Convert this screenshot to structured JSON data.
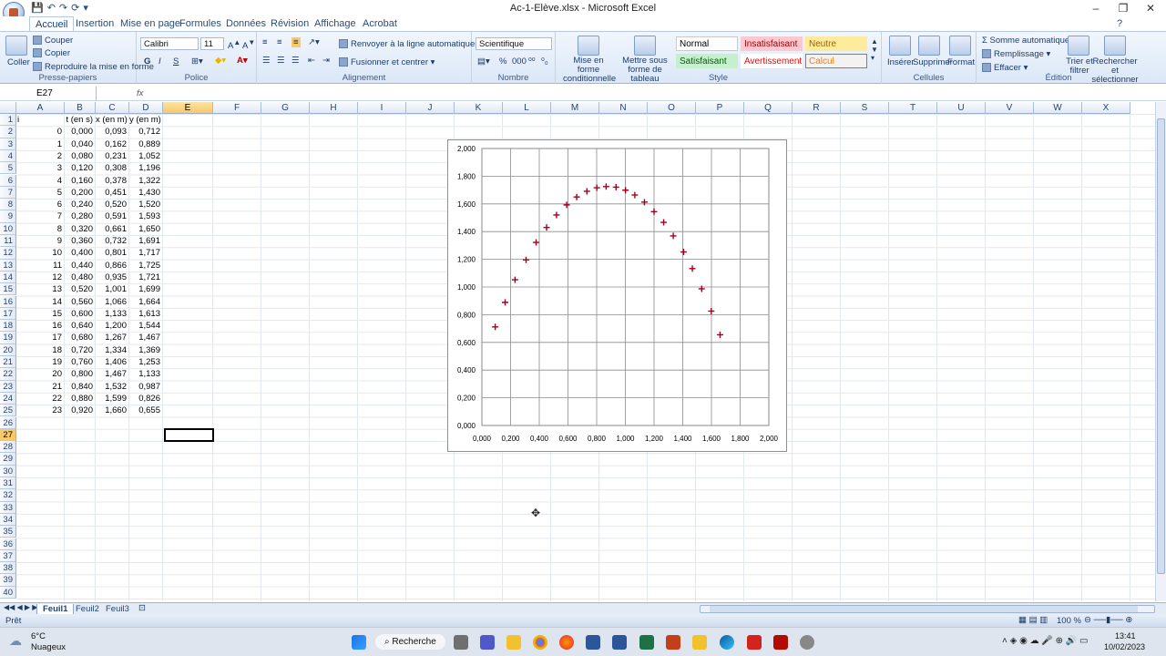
{
  "window": {
    "title": "Ac-1-Elève.xlsx - Microsoft Excel",
    "minimize": "–",
    "restore": "❐",
    "close": "✕",
    "qat_icons": [
      "save-icon",
      "undo-icon",
      "redo-icon",
      "refresh-icon",
      "customize-icon"
    ]
  },
  "tabs": [
    "Accueil",
    "Insertion",
    "Mise en page",
    "Formules",
    "Données",
    "Révision",
    "Affichage",
    "Acrobat"
  ],
  "active_tab": "Accueil",
  "ribbon": {
    "clipboard": {
      "label": "Presse-papiers",
      "paste": "Coller",
      "cut": "Couper",
      "copy": "Copier",
      "format_painter": "Reproduire la mise en forme"
    },
    "font": {
      "label": "Police",
      "font_name": "Calibri",
      "font_size": "11",
      "bold": "G",
      "italic": "I",
      "underline": "S"
    },
    "alignment": {
      "label": "Alignement",
      "wrap": "Renvoyer à la ligne automatiquement",
      "merge": "Fusionner et centrer"
    },
    "number": {
      "label": "Nombre",
      "format": "Scientifique",
      "percent": "%",
      "thousands": "000"
    },
    "styles": {
      "label": "Style",
      "conditional": "Mise en forme conditionnelle",
      "table": "Mettre sous forme de tableau",
      "cells": [
        {
          "text": "Normal",
          "bg": "#ffffff",
          "fg": "#000000",
          "border": "#c9c9c9"
        },
        {
          "text": "Insatisfaisant",
          "bg": "#ffc7ce",
          "fg": "#9c0006",
          "border": "#ffc7ce"
        },
        {
          "text": "Neutre",
          "bg": "#ffeb9c",
          "fg": "#9c6500",
          "border": "#ffeb9c"
        },
        {
          "text": "Satisfaisant",
          "bg": "#c6efce",
          "fg": "#006100",
          "border": "#c6efce"
        },
        {
          "text": "Avertissement",
          "bg": "#ffffff",
          "fg": "#ff0000",
          "border": "#ffffff"
        },
        {
          "text": "Calcul",
          "bg": "#f2f2f2",
          "fg": "#fa7d00",
          "border": "#7f7f7f"
        }
      ]
    },
    "cells_group": {
      "label": "Cellules",
      "insert": "Insérer",
      "delete": "Supprimer",
      "format": "Format"
    },
    "editing": {
      "label": "Édition",
      "autosum": "Somme automatique",
      "fill": "Remplissage",
      "clear": "Effacer",
      "sort": "Trier et filtrer",
      "find": "Rechercher et sélectionner"
    }
  },
  "formula_bar": {
    "name_box": "E27",
    "fx": "fx",
    "content": ""
  },
  "columns": [
    "A",
    "B",
    "C",
    "D",
    "E",
    "F",
    "G",
    "H",
    "I",
    "J",
    "K",
    "L",
    "M",
    "N",
    "O",
    "P",
    "Q",
    "R",
    "S",
    "T",
    "U",
    "V",
    "W",
    "X"
  ],
  "selected_column": "E",
  "selected_row": 27,
  "rows": [
    "1",
    "2",
    "3",
    "4",
    "5",
    "6",
    "7",
    "8",
    "9",
    "10",
    "11",
    "12",
    "13",
    "14",
    "15",
    "16",
    "17",
    "18",
    "19",
    "20",
    "21",
    "22",
    "23",
    "24",
    "25",
    "26",
    "27",
    "28",
    "29",
    "30",
    "31",
    "32",
    "33",
    "34",
    "35",
    "36",
    "37",
    "38",
    "39",
    "40"
  ],
  "table": {
    "headers": [
      "i",
      "t (en s)",
      "x (en m)",
      "y (en m)"
    ],
    "data": [
      [
        "0",
        "0,000",
        "0,093",
        "0,712"
      ],
      [
        "1",
        "0,040",
        "0,162",
        "0,889"
      ],
      [
        "2",
        "0,080",
        "0,231",
        "1,052"
      ],
      [
        "3",
        "0,120",
        "0,308",
        "1,196"
      ],
      [
        "4",
        "0,160",
        "0,378",
        "1,322"
      ],
      [
        "5",
        "0,200",
        "0,451",
        "1,430"
      ],
      [
        "6",
        "0,240",
        "0,520",
        "1,520"
      ],
      [
        "7",
        "0,280",
        "0,591",
        "1,593"
      ],
      [
        "8",
        "0,320",
        "0,661",
        "1,650"
      ],
      [
        "9",
        "0,360",
        "0,732",
        "1,691"
      ],
      [
        "10",
        "0,400",
        "0,801",
        "1,717"
      ],
      [
        "11",
        "0,440",
        "0,866",
        "1,725"
      ],
      [
        "12",
        "0,480",
        "0,935",
        "1,721"
      ],
      [
        "13",
        "0,520",
        "1,001",
        "1,699"
      ],
      [
        "14",
        "0,560",
        "1,066",
        "1,664"
      ],
      [
        "15",
        "0,600",
        "1,133",
        "1,613"
      ],
      [
        "16",
        "0,640",
        "1,200",
        "1,544"
      ],
      [
        "17",
        "0,680",
        "1,267",
        "1,467"
      ],
      [
        "18",
        "0,720",
        "1,334",
        "1,369"
      ],
      [
        "19",
        "0,760",
        "1,406",
        "1,253"
      ],
      [
        "20",
        "0,800",
        "1,467",
        "1,133"
      ],
      [
        "21",
        "0,840",
        "1,532",
        "0,987"
      ],
      [
        "22",
        "0,880",
        "1,599",
        "0,826"
      ],
      [
        "23",
        "0,920",
        "1,660",
        "0,655"
      ]
    ]
  },
  "chart_data": {
    "type": "scatter",
    "marker": "+",
    "color": "#a0001c",
    "xlim": [
      0,
      2
    ],
    "ylim": [
      0,
      2
    ],
    "x_ticks": [
      "0,000",
      "0,200",
      "0,400",
      "0,600",
      "0,800",
      "1,000",
      "1,200",
      "1,400",
      "1,600",
      "1,800",
      "2,000"
    ],
    "y_ticks": [
      "0,000",
      "0,200",
      "0,400",
      "0,600",
      "0,800",
      "1,000",
      "1,200",
      "1,400",
      "1,600",
      "1,800",
      "2,000"
    ],
    "grid": true,
    "x": [
      0.093,
      0.162,
      0.231,
      0.308,
      0.378,
      0.451,
      0.52,
      0.591,
      0.661,
      0.732,
      0.801,
      0.866,
      0.935,
      1.001,
      1.066,
      1.133,
      1.2,
      1.267,
      1.334,
      1.406,
      1.467,
      1.532,
      1.599,
      1.66
    ],
    "y": [
      0.712,
      0.889,
      1.052,
      1.196,
      1.322,
      1.43,
      1.52,
      1.593,
      1.65,
      1.691,
      1.717,
      1.725,
      1.721,
      1.699,
      1.664,
      1.613,
      1.544,
      1.467,
      1.369,
      1.253,
      1.133,
      0.987,
      0.826,
      0.655
    ]
  },
  "sheets": [
    "Feuil1",
    "Feuil2",
    "Feuil3"
  ],
  "active_sheet": "Feuil1",
  "status": {
    "ready": "Prêt",
    "zoom": "100 %"
  },
  "taskbar": {
    "weather_temp": "6°C",
    "weather_text": "Nuageux",
    "search": "Recherche",
    "time": "13:41",
    "date": "10/02/2023"
  }
}
